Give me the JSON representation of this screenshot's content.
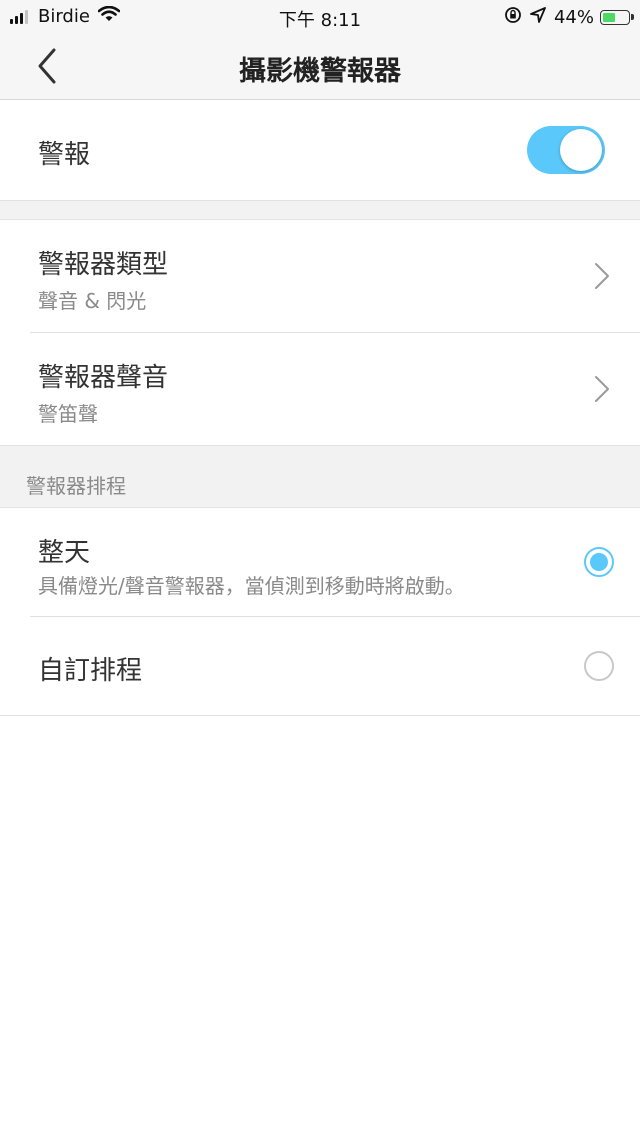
{
  "status_bar": {
    "carrier": "Birdie",
    "time": "下午 8:11",
    "battery_percent": "44%",
    "battery_level": 0.44,
    "icons": [
      "signal-icon",
      "wifi-icon",
      "orientation-lock-icon",
      "location-icon",
      "battery-charging-icon"
    ]
  },
  "nav": {
    "title": "攝影機警報器",
    "back_icon": "chevron-left-icon"
  },
  "alarm": {
    "label": "警報",
    "enabled": true
  },
  "settings": [
    {
      "label": "警報器類型",
      "value": "聲音 & 閃光",
      "icon": "chevron-right-icon"
    },
    {
      "label": "警報器聲音",
      "value": "警笛聲",
      "icon": "chevron-right-icon"
    }
  ],
  "schedule": {
    "header": "警報器排程",
    "options": [
      {
        "label": "整天",
        "description": "具備燈光/聲音警報器，當偵測到移動時將啟動。",
        "selected": true
      },
      {
        "label": "自訂排程",
        "selected": false
      }
    ]
  },
  "colors": {
    "accent": "#5ac8fa",
    "background_gray": "#f2f2f2",
    "secondary_text": "#8a8a8a"
  }
}
